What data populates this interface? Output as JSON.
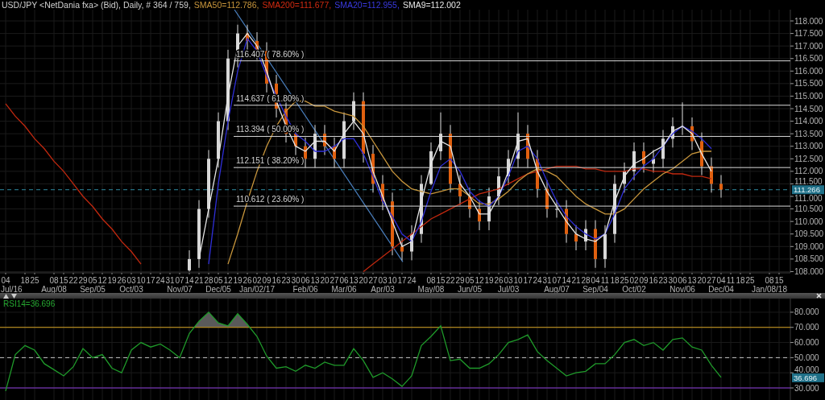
{
  "header": {
    "items": [
      {
        "text": "USD/JPY <NetDania fxa> (Bid), Daily, # 364 / 759,",
        "color": "#d0d0d0"
      },
      {
        "text": "SMA50=112.786,",
        "color": "#c8963c"
      },
      {
        "text": "SMA200=111.677,",
        "color": "#d22a10"
      },
      {
        "text": "SMA20=112.955,",
        "color": "#3a3ae0"
      },
      {
        "text": "SMA9=112.002",
        "color": "#e6e6e6"
      }
    ]
  },
  "price_panel": {
    "chart_data": {
      "type": "candlestick",
      "grid": true,
      "categories": [
        "04",
        null,
        "18",
        "25",
        null,
        "08",
        "15",
        "22",
        "29",
        "05",
        "12",
        "19",
        "26",
        "03",
        "10",
        "17",
        "24",
        "31",
        "07",
        "14",
        "21",
        "28",
        "05",
        "12",
        "19",
        "26",
        "02",
        "09",
        "16",
        "23",
        "30",
        "06",
        "13",
        "20",
        "27",
        "06",
        "13",
        "20",
        "27",
        "03",
        "10",
        "17",
        "24",
        null,
        "08",
        "15",
        "22",
        "29",
        "05",
        "12",
        "19",
        "26",
        "03",
        "10",
        "17",
        "24",
        "31",
        "07",
        "14",
        "21",
        "28",
        "04",
        "11",
        "18",
        "25",
        "02",
        "09",
        "16",
        "23",
        "30",
        "06",
        "13",
        "20",
        "27",
        "04",
        "11",
        "18",
        "25",
        null,
        "08",
        "15"
      ],
      "ohlc": [
        null,
        null,
        null,
        null,
        null,
        null,
        null,
        null,
        null,
        null,
        null,
        null,
        null,
        null,
        null,
        null,
        null,
        null,
        null,
        [
          108.05,
          108.85,
          108.0,
          108.5
        ],
        [
          108.5,
          110.85,
          108.15,
          110.5
        ],
        [
          110.5,
          112.85,
          110.15,
          112.5
        ],
        [
          112.5,
          114.35,
          112.15,
          114
        ],
        [
          114,
          116.85,
          113.65,
          116.5
        ],
        [
          116.5,
          117.85,
          116.15,
          117.5
        ],
        [
          117.5,
          117.85,
          116.85,
          117.2
        ],
        [
          117.2,
          117.55,
          116.45,
          116.8
        ],
        [
          116.8,
          117.15,
          115.15,
          115.5
        ],
        [
          115.5,
          115.85,
          114.15,
          114.5
        ],
        [
          114.5,
          114.85,
          113.15,
          113.5
        ],
        [
          113.5,
          113.85,
          112.65,
          113
        ],
        [
          113,
          113.35,
          112.15,
          112.5
        ],
        [
          112.5,
          113.85,
          112.15,
          113.5
        ],
        [
          113.5,
          113.85,
          112.65,
          113
        ],
        [
          113,
          113.35,
          112.15,
          112.5
        ],
        [
          112.5,
          114.35,
          112.15,
          114
        ],
        [
          114,
          115.15,
          113.65,
          114.8
        ],
        [
          114.8,
          115.15,
          112.35,
          112.7
        ],
        [
          112.7,
          113.05,
          111.15,
          111.5
        ],
        [
          111.5,
          111.85,
          110.45,
          110.8
        ],
        [
          110.8,
          111.15,
          108.65,
          109
        ],
        [
          109,
          109.35,
          108.45,
          108.8
        ],
        [
          108.8,
          109.85,
          108.45,
          109.5
        ],
        [
          109.5,
          111.85,
          109.15,
          111.5
        ],
        [
          111.5,
          113.15,
          111.45,
          112.8
        ],
        [
          112.8,
          114.35,
          112.45,
          113.5
        ],
        [
          113.5,
          113.85,
          111.15,
          111.5
        ],
        [
          111.5,
          111.85,
          110.65,
          111
        ],
        [
          111,
          111.35,
          110.15,
          110.5
        ],
        [
          110.5,
          110.85,
          109.65,
          110
        ],
        [
          110,
          111.35,
          109.65,
          111
        ],
        [
          111,
          112.15,
          110.65,
          111.8
        ],
        [
          111.8,
          112.85,
          111.45,
          112.5
        ],
        [
          112.5,
          114.35,
          112.15,
          113.5
        ],
        [
          113.5,
          113.85,
          112.15,
          112.5
        ],
        [
          112.5,
          112.85,
          110.95,
          111.3
        ],
        [
          111.3,
          111.65,
          110.15,
          110.5
        ],
        [
          110.5,
          110.85,
          110.15,
          110.5
        ],
        [
          110.5,
          110.85,
          109.15,
          109.5
        ],
        [
          109.5,
          109.85,
          108.85,
          109.2
        ],
        [
          109.2,
          110.05,
          108.85,
          109.7
        ],
        [
          109.7,
          110.05,
          108.15,
          108.5
        ],
        [
          108.5,
          109.85,
          108.15,
          109.5
        ],
        [
          109.5,
          111.85,
          109.15,
          111.5
        ],
        [
          111.5,
          112.35,
          111.15,
          112
        ],
        [
          112,
          113.15,
          111.65,
          112.8
        ],
        [
          112.8,
          113.15,
          111.95,
          112.3
        ],
        [
          112.3,
          112.85,
          111.95,
          112.5
        ],
        [
          112.5,
          113.65,
          112.15,
          113.3
        ],
        [
          113.3,
          114.15,
          112.95,
          113.8
        ],
        [
          113.8,
          114.75,
          113.45,
          113.8
        ],
        [
          113.8,
          114.15,
          112.85,
          113.2
        ],
        [
          113.2,
          113.55,
          111.85,
          112.2
        ],
        [
          112.2,
          112.55,
          111.15,
          111.5
        ],
        [
          111.5,
          111.85,
          110.95,
          111.27
        ],
        null,
        null,
        null,
        null,
        null,
        null
      ],
      "series": [
        {
          "type": "line",
          "color": "#c0280f",
          "values": [
            114.7,
            114.2,
            113.8,
            113.3,
            112.9,
            112.4,
            112.0,
            111.5,
            111.0,
            110.6,
            110.1,
            109.7,
            109.2,
            108.8,
            108.3,
            null,
            null,
            null,
            null,
            null,
            null,
            null,
            null,
            null,
            null,
            null,
            null,
            null,
            null,
            null,
            null,
            null,
            null,
            null,
            null,
            null,
            null,
            108.0,
            108.3,
            108.6,
            108.9,
            109.2,
            109.5,
            109.8,
            110.1,
            110.3,
            110.5,
            110.7,
            110.9,
            111.1,
            111.2,
            111.3,
            111.5,
            111.7,
            111.9,
            112.0,
            112.1,
            112.2,
            112.2,
            112.2,
            112.1,
            112.1,
            112.0,
            112.0,
            112.0,
            112.1,
            112.1,
            112.0,
            112.0,
            111.9,
            111.9,
            111.8,
            111.8,
            111.7,
            null,
            null,
            null,
            null,
            null,
            null,
            null
          ]
        },
        {
          "type": "line",
          "color": "#c8963c",
          "values": [
            null,
            null,
            null,
            null,
            null,
            null,
            null,
            null,
            null,
            null,
            null,
            null,
            null,
            null,
            null,
            null,
            null,
            null,
            null,
            null,
            null,
            null,
            null,
            108.3,
            109.5,
            110.8,
            112,
            113,
            113.8,
            114.4,
            114.8,
            114.8,
            114.6,
            114.6,
            114.4,
            114.3,
            114.2,
            113.8,
            113.2,
            112.6,
            112.0,
            111.6,
            111.3,
            111.2,
            111.1,
            111.2,
            111.3,
            111.3,
            111.0,
            110.7,
            110.7,
            110.9,
            111.2,
            111.6,
            111.9,
            112.1,
            112.0,
            111.8,
            111.4,
            111.0,
            110.7,
            110.5,
            110.3,
            110.3,
            110.5,
            110.9,
            111.3,
            111.6,
            111.9,
            112.1,
            112.4,
            112.7,
            112.8,
            112.8,
            null,
            null,
            null,
            null,
            null,
            null,
            null
          ]
        },
        {
          "type": "line",
          "color": "#2f2fd8",
          "values": [
            null,
            null,
            null,
            null,
            null,
            null,
            null,
            null,
            null,
            null,
            null,
            null,
            null,
            null,
            null,
            null,
            null,
            null,
            null,
            null,
            null,
            108.3,
            111.5,
            114.0,
            116.0,
            117.3,
            116.8,
            115.8,
            115.0,
            114.2,
            113.5,
            113.2,
            112.8,
            112.8,
            113.0,
            113.3,
            113.3,
            112.7,
            111.8,
            110.8,
            110.2,
            109.5,
            109.2,
            110.0,
            111.2,
            112.2,
            112.5,
            112.0,
            111.2,
            110.8,
            110.6,
            111.0,
            111.8,
            112.8,
            113.0,
            112.5,
            111.6,
            110.8,
            110.2,
            109.8,
            109.5,
            109.3,
            109.5,
            110.3,
            111.3,
            111.8,
            112.2,
            112.5,
            113.0,
            113.5,
            113.8,
            113.6,
            113.3,
            112.9,
            null,
            null,
            null,
            null,
            null,
            null,
            null
          ]
        },
        {
          "type": "line",
          "color": "#e6e6e6",
          "values": [
            null,
            null,
            null,
            null,
            null,
            null,
            null,
            null,
            null,
            null,
            null,
            null,
            null,
            null,
            null,
            null,
            null,
            null,
            null,
            null,
            108.5,
            110.5,
            112.5,
            115.0,
            117.0,
            117.5,
            117.0,
            116.0,
            114.8,
            113.8,
            113.0,
            112.8,
            113.2,
            113.2,
            112.8,
            113.5,
            114.0,
            113.5,
            112.0,
            111.0,
            110.0,
            109.0,
            109.2,
            110.8,
            112.3,
            113.2,
            113.0,
            111.5,
            111.0,
            110.3,
            110.3,
            111.0,
            112.0,
            113.2,
            113.3,
            112.0,
            111.2,
            110.6,
            110.0,
            109.5,
            109.3,
            109.2,
            109.5,
            110.8,
            111.8,
            112.3,
            112.5,
            112.8,
            113.0,
            113.6,
            113.8,
            113.5,
            112.7,
            112.0,
            null,
            null,
            null,
            null,
            null,
            null,
            null
          ]
        }
      ],
      "ylim": [
        107.95,
        118.45
      ],
      "yticks": [
        {
          "value": 108,
          "label": "108.000"
        },
        {
          "value": 108.5,
          "label": "108.500"
        },
        {
          "value": 109,
          "label": "109.000"
        },
        {
          "value": 109.5,
          "label": "109.500"
        },
        {
          "value": 110,
          "label": "110.000"
        },
        {
          "value": 110.5,
          "label": "110.500"
        },
        {
          "value": 111,
          "label": "111.000"
        },
        {
          "value": 111.5,
          "label": "111.500"
        },
        {
          "value": 112,
          "label": "112.000"
        },
        {
          "value": 112.5,
          "label": "112.500"
        },
        {
          "value": 113,
          "label": "113.000"
        },
        {
          "value": 113.5,
          "label": "113.500"
        },
        {
          "value": 114,
          "label": "114.000"
        },
        {
          "value": 114.5,
          "label": "114.500"
        },
        {
          "value": 115,
          "label": "115.000"
        },
        {
          "value": 115.5,
          "label": "115.500"
        },
        {
          "value": 116,
          "label": "116.000"
        },
        {
          "value": 116.5,
          "label": "116.500"
        },
        {
          "value": 117,
          "label": "117.000"
        },
        {
          "value": 117.5,
          "label": "117.500"
        },
        {
          "value": 118,
          "label": "118.000"
        }
      ],
      "ref_lines": [
        {
          "axis": "y",
          "value": 116.407,
          "label": "116.407 ( 78.60% )"
        },
        {
          "axis": "y",
          "value": 114.637,
          "label": "114.637 ( 61.80% )"
        },
        {
          "axis": "y",
          "value": 113.394,
          "label": "113.394 ( 50.00% )"
        },
        {
          "axis": "y",
          "value": 112.151,
          "label": "112.151 ( 38.20% )"
        },
        {
          "axis": "y",
          "value": 110.612,
          "label": "110.612 ( 23.60% )"
        },
        {
          "axis": "y",
          "value": 111.266,
          "label": "111.266"
        }
      ]
    },
    "month_labels": [
      "Jul/16",
      "Aug/08",
      "Sep/05",
      "Oct/03",
      "Nov/07",
      "Dec/05",
      "Jan/02/17",
      "Feb/06",
      "Mar/06",
      "Apr/03",
      "May/08",
      "Jun/05",
      "Jul/03",
      "Aug/07",
      "Sep/04",
      "Oct/02",
      "Nov/06",
      "Dec/04",
      "Jan/08/18"
    ]
  },
  "rsi_panel": {
    "chart_data": {
      "type": "line",
      "grid": true,
      "title": "RSI14=36.696",
      "categories": [
        null,
        null,
        null,
        null,
        null,
        null,
        null,
        null,
        null,
        null,
        null,
        null,
        null,
        null,
        null,
        null,
        null,
        null,
        null,
        null,
        null,
        null,
        null,
        null,
        null,
        null,
        null,
        null,
        null,
        null,
        null,
        null,
        null,
        null,
        null,
        null,
        null,
        null,
        null,
        null,
        null,
        null,
        null,
        null,
        null,
        null,
        null,
        null,
        null,
        null,
        null,
        null,
        null,
        null,
        null,
        null,
        null,
        null,
        null,
        null,
        null,
        null,
        null,
        null,
        null,
        null,
        null,
        null,
        null,
        null,
        null,
        null,
        null,
        null,
        null,
        null,
        null,
        null,
        null,
        null,
        null
      ],
      "series": [
        {
          "color": "#1f9a2a",
          "values": [
            28,
            52,
            58,
            55,
            46,
            42,
            38,
            44,
            56,
            50,
            52,
            43,
            40,
            55,
            60,
            57,
            59,
            55,
            50,
            66,
            74,
            80,
            73,
            71,
            79,
            72,
            64,
            51,
            43,
            44,
            41,
            45,
            43,
            47,
            45,
            45,
            56,
            48,
            37,
            40,
            36,
            31,
            38,
            58,
            64,
            71,
            48,
            49,
            43,
            43,
            46,
            52,
            60,
            62,
            65,
            54,
            48,
            43,
            38,
            40,
            41,
            46,
            46,
            52,
            60,
            62,
            58,
            60,
            55,
            62,
            63,
            57,
            55,
            45,
            37,
            null,
            null,
            null,
            null,
            null,
            null
          ]
        }
      ],
      "ylim": [
        21.5,
        89
      ],
      "yticks": [
        {
          "value": 30,
          "label": "30.000"
        },
        {
          "value": 40,
          "label": "40.000"
        },
        {
          "value": 50,
          "label": "50.000"
        },
        {
          "value": 60,
          "label": "60.000"
        },
        {
          "value": 70,
          "label": "70.000"
        },
        {
          "value": 80,
          "label": "80.000"
        }
      ],
      "ref_lines": [
        {
          "axis": "y",
          "value": 70
        },
        {
          "axis": "y",
          "value": 50
        },
        {
          "axis": "y",
          "value": 30
        }
      ]
    },
    "last_value": "36.696"
  }
}
